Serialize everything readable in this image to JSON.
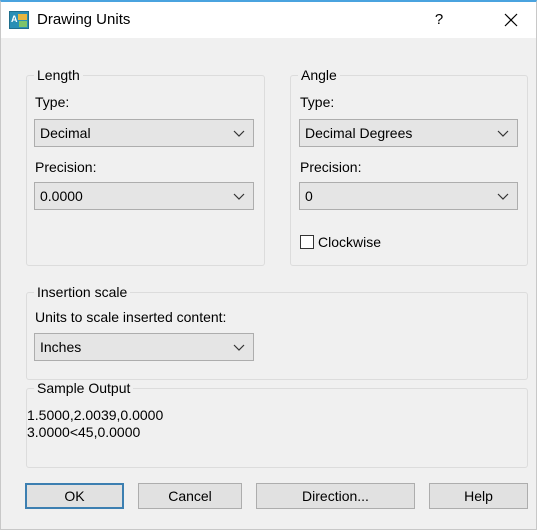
{
  "window": {
    "title": "Drawing Units",
    "help_label": "?",
    "app_icon": "autocad-units-icon",
    "close_icon": "close-icon"
  },
  "length": {
    "group_label": "Length",
    "type_label": "Type:",
    "type_value": "Decimal",
    "precision_label": "Precision:",
    "precision_value": "0.0000"
  },
  "angle": {
    "group_label": "Angle",
    "type_label": "Type:",
    "type_value": "Decimal Degrees",
    "precision_label": "Precision:",
    "precision_value": "0",
    "clockwise_label": "Clockwise",
    "clockwise_checked": false
  },
  "insertion": {
    "group_label": "Insertion scale",
    "units_label": "Units to scale inserted content:",
    "units_value": "Inches"
  },
  "sample": {
    "group_label": "Sample Output",
    "lines": [
      "1.5000,2.0039,0.0000",
      "3.0000<45,0.0000"
    ]
  },
  "buttons": {
    "ok": "OK",
    "cancel": "Cancel",
    "direction": "Direction...",
    "help": "Help"
  },
  "colors": {
    "title_accent": "#4aa3df",
    "default_button_border": "#3c7fb1",
    "dialog_background": "#f0f0f0"
  }
}
